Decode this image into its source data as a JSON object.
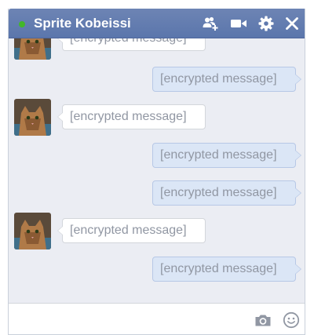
{
  "header": {
    "contact_name": "Sprite Kobeissi",
    "online_status": "online",
    "icons": [
      "add-friend-icon",
      "video-call-icon",
      "gear-icon",
      "close-icon"
    ]
  },
  "messages": [
    {
      "direction": "incoming",
      "text": "[encrypted message]",
      "partial": true
    },
    {
      "direction": "outgoing",
      "text": "[encrypted message]"
    },
    {
      "direction": "incoming",
      "text": "[encrypted message]"
    },
    {
      "direction": "outgoing",
      "text": "[encrypted message]"
    },
    {
      "direction": "outgoing",
      "text": "[encrypted message]"
    },
    {
      "direction": "incoming",
      "text": "[encrypted message]"
    },
    {
      "direction": "outgoing",
      "text": "[encrypted message]"
    }
  ],
  "composer": {
    "value": "",
    "placeholder": "",
    "icons": [
      "camera-icon",
      "emoji-icon"
    ]
  },
  "colors": {
    "header_bg": "#5b76ac",
    "online_dot": "#42b72a",
    "outgoing_bubble": "#dbe6f6",
    "incoming_bubble": "#ffffff",
    "message_text": "#9197a3"
  }
}
